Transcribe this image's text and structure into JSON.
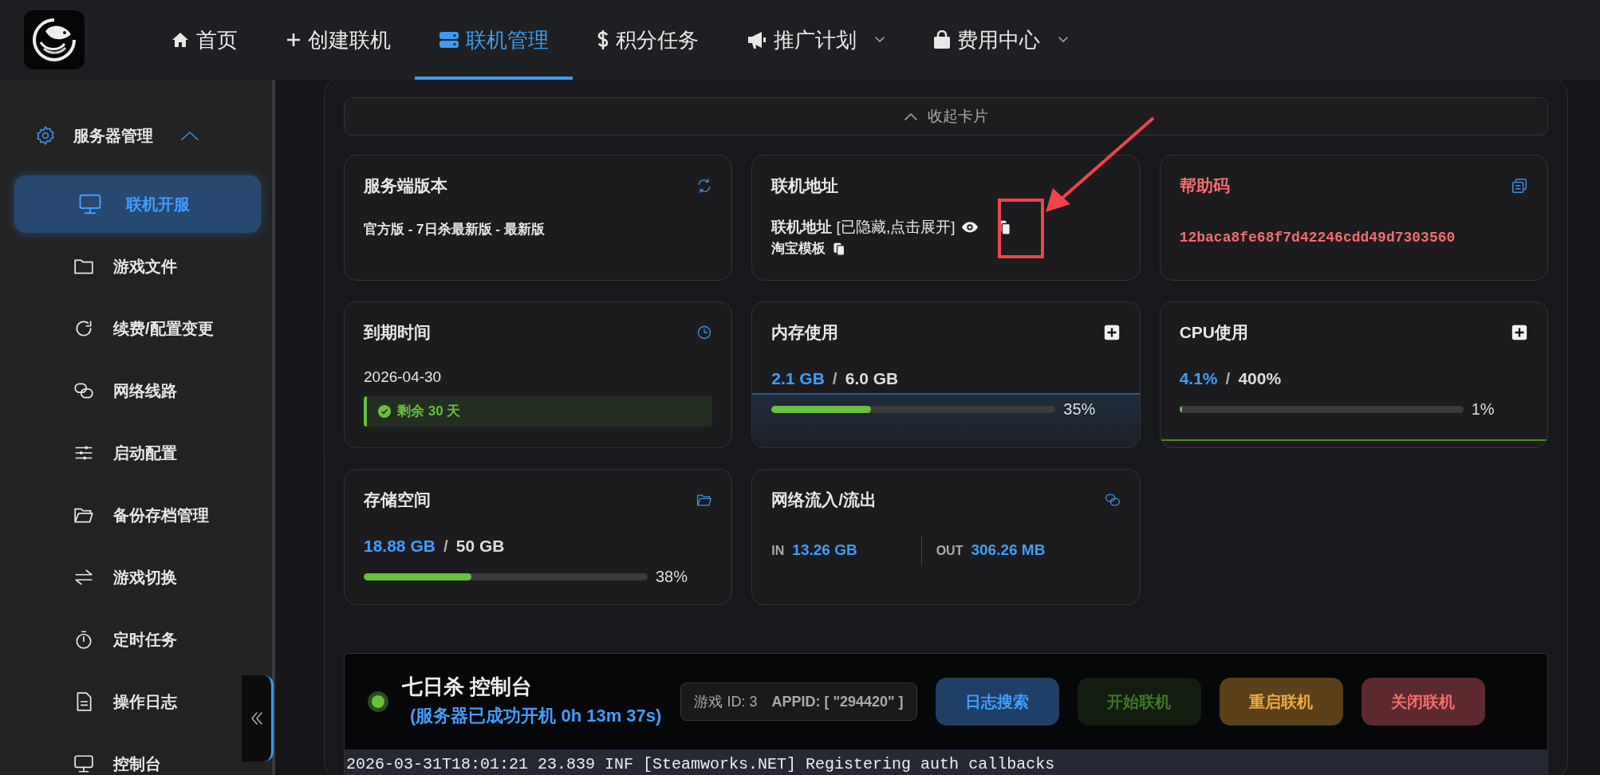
{
  "nav": {
    "items": [
      {
        "label": "首页",
        "selected": false,
        "dropdown": false
      },
      {
        "label": "创建联机",
        "selected": false,
        "dropdown": false
      },
      {
        "label": "联机管理",
        "selected": true,
        "dropdown": false
      },
      {
        "label": "积分任务",
        "selected": false,
        "dropdown": false
      },
      {
        "label": "推广计划",
        "selected": false,
        "dropdown": true
      },
      {
        "label": "费用中心",
        "selected": false,
        "dropdown": true
      }
    ]
  },
  "sidebar": {
    "group": {
      "label": "服务器管理",
      "expanded": true
    },
    "items": [
      {
        "label": "联机开服",
        "selected": true
      },
      {
        "label": "游戏文件",
        "selected": false
      },
      {
        "label": "续费/配置变更",
        "selected": false
      },
      {
        "label": "网络线路",
        "selected": false
      },
      {
        "label": "启动配置",
        "selected": false
      },
      {
        "label": "备份存档管理",
        "selected": false
      },
      {
        "label": "游戏切换",
        "selected": false
      },
      {
        "label": "定时任务",
        "selected": false
      },
      {
        "label": "操作日志",
        "selected": false
      },
      {
        "label": "控制台",
        "selected": false
      }
    ]
  },
  "collapse_bar": {
    "label": "收起卡片"
  },
  "cards": [
    {
      "kind": "text",
      "title": "服务端版本",
      "text": "官方版 - 7日杀最新版 - 最新版"
    },
    {
      "kind": "address",
      "title": "联机地址",
      "address": "**联机地址** [已隐藏,点击展开]",
      "template": "淘宝模板"
    },
    {
      "kind": "code",
      "title": "帮助码",
      "code": "12baca8fe68f7d42246cdd49d7303560"
    },
    {
      "kind": "expiry",
      "title": "到期时间",
      "date": "2026-04-30",
      "remaining": "剩余 30 天"
    },
    {
      "kind": "meter",
      "title": "内存使用",
      "used": "2.1 GB",
      "separator": "/",
      "total": "6.0 GB",
      "level": 0.35,
      "percent": "35%"
    },
    {
      "kind": "meter",
      "title": "CPU使用",
      "used": "4.1%",
      "separator": "/",
      "total": "400%",
      "level": 0.01,
      "percent": "1%"
    },
    {
      "kind": "meter",
      "title": "存储空间",
      "used": "18.88 GB",
      "separator": "/",
      "total": "50 GB",
      "level": 0.38,
      "percent": "38%"
    },
    {
      "kind": "network",
      "title": "网络流入/流出",
      "in_label": "IN",
      "in_value": "13.26 GB",
      "out_label": "OUT",
      "out_value": "306.26 MB"
    }
  ],
  "console": {
    "title": "七日杀 控制台",
    "status": "(服务器已成功开机 0h 13m 37s)",
    "running": true,
    "game_id": "游戏 ID: 3",
    "appid": "APPID: [ \"294420\" ]",
    "buttons": [
      {
        "label": "日志搜索",
        "kind": "info"
      },
      {
        "label": "开始联机",
        "kind": "start",
        "disabled": true
      },
      {
        "label": "重启联机",
        "kind": "restart",
        "disabled": false
      },
      {
        "label": "关闭联机",
        "kind": "stop",
        "disabled": false
      }
    ],
    "log": [
      "2026-03-31T18:01:21 23.839 INF [Steamworks.NET] Registering auth callbacks"
    ]
  }
}
